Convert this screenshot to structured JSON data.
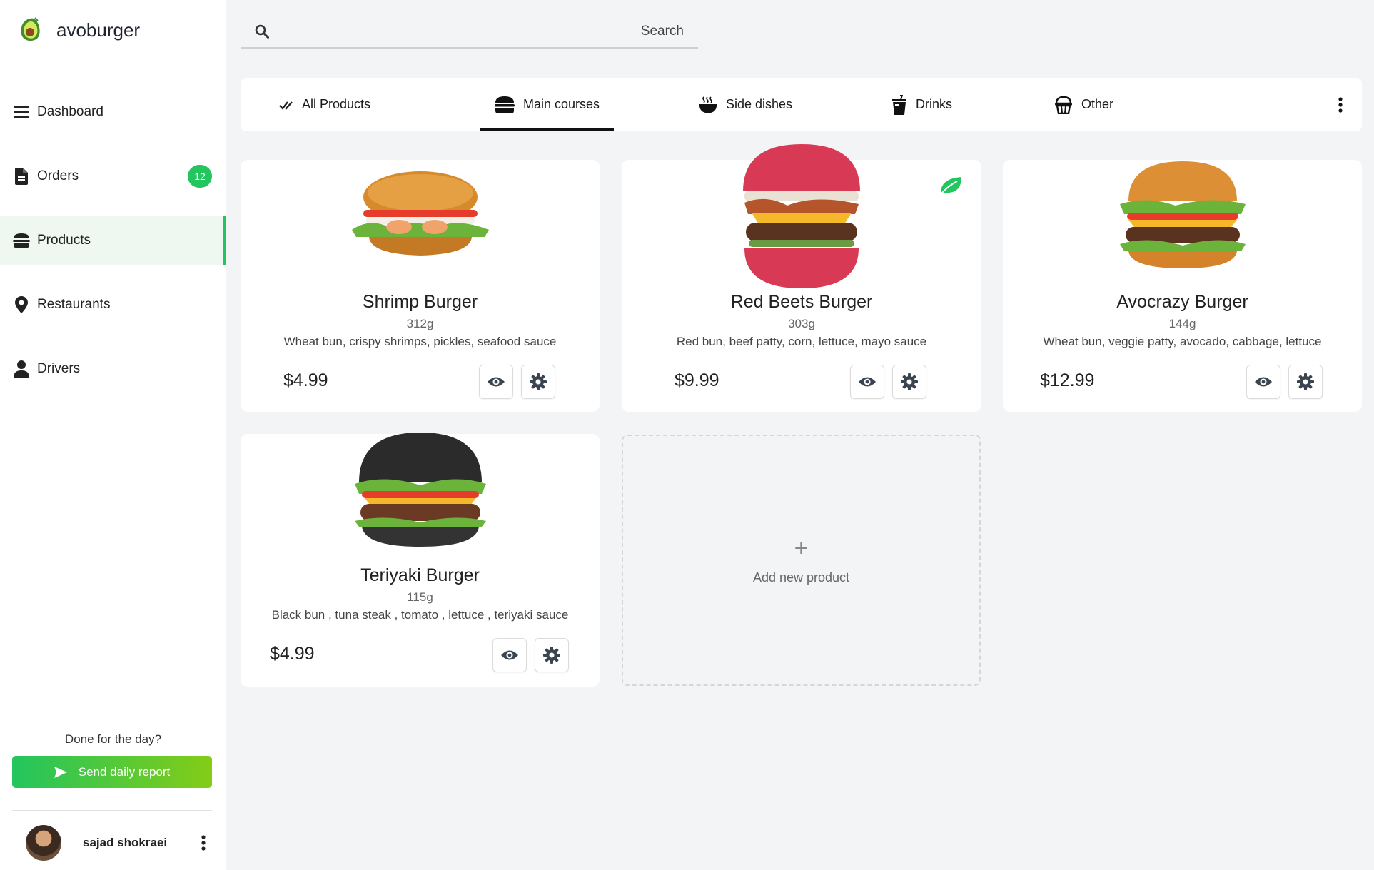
{
  "brand": {
    "name": "avoburger",
    "accent": "#22c55e"
  },
  "sidebar": {
    "items": [
      {
        "label": "Dashboard",
        "icon": "bars-icon"
      },
      {
        "label": "Orders",
        "icon": "document-icon",
        "badge": "12"
      },
      {
        "label": "Products",
        "icon": "burger-icon",
        "active": true
      },
      {
        "label": "Restaurants",
        "icon": "map-pin-icon"
      },
      {
        "label": "Drivers",
        "icon": "user-icon"
      }
    ],
    "done_text": "Done for the day?",
    "report_button": "Send daily report",
    "user_name": "sajad shokraei"
  },
  "search": {
    "placeholder": "Search"
  },
  "tabs": [
    {
      "label": "All Products",
      "icon": "double-check-icon"
    },
    {
      "label": "Main courses",
      "icon": "burger-icon",
      "active": true
    },
    {
      "label": "Side dishes",
      "icon": "bowl-icon"
    },
    {
      "label": "Drinks",
      "icon": "cup-icon"
    },
    {
      "label": "Other",
      "icon": "cupcake-icon"
    }
  ],
  "products": [
    {
      "name": "Shrimp Burger",
      "weight": "312g",
      "description": "Wheat bun, crispy shrimps, pickles, seafood sauce",
      "price": "$4.99"
    },
    {
      "name": "Red Beets Burger",
      "weight": "303g",
      "description": "Red bun, beef patty, corn, lettuce, mayo sauce",
      "price": "$9.99",
      "vegan": true
    },
    {
      "name": "Avocrazy Burger",
      "weight": "144g",
      "description": "Wheat bun, veggie patty, avocado, cabbage, lettuce",
      "price": "$12.99"
    },
    {
      "name": "Teriyaki Burger",
      "weight": "115g",
      "description": "Black bun , tuna steak , tomato , lettuce , teriyaki sauce",
      "price": "$4.99"
    }
  ],
  "add_product": {
    "plus": "+",
    "label": "Add new product"
  }
}
